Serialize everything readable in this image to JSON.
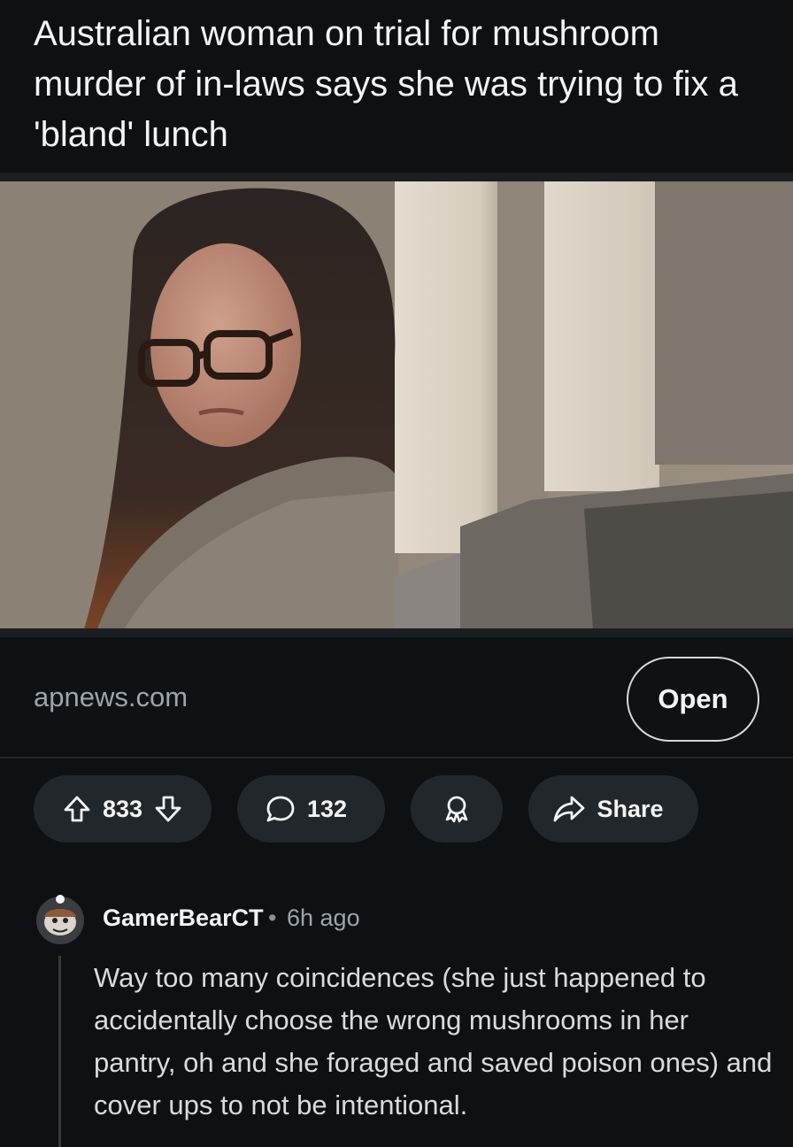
{
  "post": {
    "title": "Australian woman on trial for mushroom murder of in-laws says she was trying to fix a 'bland' lunch"
  },
  "link": {
    "domain": "apnews.com",
    "open_label": "Open"
  },
  "actions": {
    "vote_count": "833",
    "comment_count": "132",
    "share_label": "Share"
  },
  "comment": {
    "author": "GamerBearCT",
    "separator": "•",
    "time": "6h ago",
    "body": "Way too many coincidences (she just happened to accidentally choose the wrong mushrooms in her pantry, oh and she foraged and saved poison ones) and cover ups to not be intentional."
  },
  "icons": {
    "upvote": "upvote-arrow-icon",
    "downvote": "downvote-arrow-icon",
    "comment": "comment-bubble-icon",
    "award": "award-ribbon-icon",
    "share": "share-arrow-icon"
  },
  "colors": {
    "background": "#0e1113",
    "pill": "#22272b",
    "muted_text": "#9ea4aa"
  }
}
